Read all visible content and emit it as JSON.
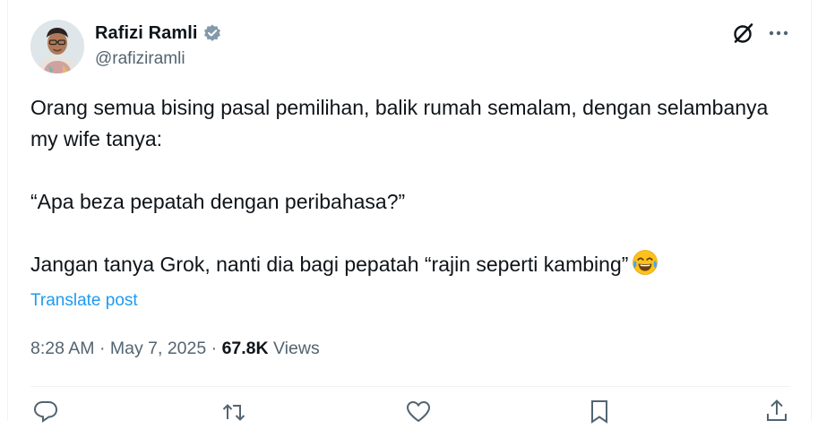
{
  "author": {
    "display_name": "Rafizi Ramli",
    "handle": "@rafiziramli",
    "verified": true,
    "avatar_icon": "avatar-photo"
  },
  "header_actions": {
    "grok_icon": "grok-icon",
    "more_icon": "more-icon"
  },
  "tweet": {
    "paragraphs": [
      "Orang semua bising pasal pemilihan, balik rumah semalam, dengan selambanya my wife tanya:",
      "",
      "“Apa beza pepatah dengan peribahasa?”",
      "",
      "Jangan tanya Grok, nanti dia bagi pepatah “rajin seperti kambing”"
    ],
    "emoji": "face-with-tears-of-joy"
  },
  "translate_label": "Translate post",
  "meta": {
    "time": "8:28 AM",
    "separator": " · ",
    "date": "May 7, 2025",
    "views_count": "67.8K",
    "views_label": " Views"
  },
  "action_bar": [
    "reply-icon",
    "repost-icon",
    "like-icon",
    "bookmark-icon",
    "share-icon"
  ],
  "colors": {
    "text": "#0f1419",
    "secondary": "#536471",
    "link": "#1d9bf0",
    "divider": "#eff3f4"
  }
}
